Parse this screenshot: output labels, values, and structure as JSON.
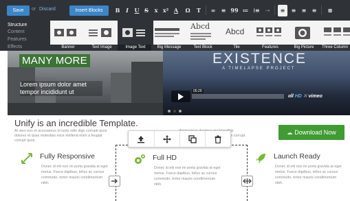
{
  "toolbar": {
    "save_label": "Save",
    "or_label": "or",
    "discard_label": "Discard",
    "insert_label": "Insert Blocks",
    "format": [
      "B",
      "I",
      "U",
      "S",
      "x",
      "x²",
      "A",
      "Ω",
      "T",
      "∞",
      "≡",
      "99",
      "≔",
      "⁝≡",
      "⇥",
      "≡",
      "≡",
      "≡",
      "≡",
      "⊞"
    ]
  },
  "categories": [
    "Structure",
    "Content",
    "Features",
    "Effects"
  ],
  "blocks": [
    "Banner",
    "Text Image",
    "Image Text",
    "Big Message",
    "Text Block",
    "Tile",
    "Features",
    "Big Picture",
    "Three Column"
  ],
  "block_text": {
    "abcd": "Abcd"
  },
  "hero": {
    "heading": "MANY MORE",
    "text": "Lorem ipsum dolor amet tempor incididunt ut",
    "video_title": "EXISTENCE",
    "video_subtitle": "A TIMELAPSE PROJECT",
    "video_time": "05:29",
    "hd_label": "HD",
    "vimeo_label": "vimeo"
  },
  "content": {
    "heading": "Unify is an incredible Template.",
    "intro": "At vero eos et accusamus et iusto odio dign corrupti quos dolores et quas molestias exce eleifend enim a feugiat corrupt quos.",
    "intro_mid": "dignissimos ducimus qui blanditiis molestias excepturi eleifend enim corrupt.",
    "download_label": "Download Now"
  },
  "features": [
    {
      "title": "Fully Responsive",
      "body": "Donec id elit non mi porta gravida at eget metus. Fusce dapibus, tellus ac cursus commodo, tortor mauris condimentum nibh."
    },
    {
      "title": "Full HD",
      "body": "Donec id elit non mi porta gravida at eget metus. Fusce dapibus, tellus ac cursus commodo, tortor mauris condimentum nibh."
    },
    {
      "title": "Launch Ready",
      "body": "Donec id elit non mi porta gravida at eget metus. Fusce dapibus, tellus ac cursus commodo, tortor mauris condimentum nibh."
    }
  ],
  "icons": {
    "float_toolbar": [
      "upload-icon",
      "move-icon",
      "duplicate-icon",
      "delete-icon"
    ],
    "features": [
      "resize-icon",
      "gears-icon",
      "rocket-icon"
    ]
  },
  "colors": {
    "toolbar_bg": "#2f3338",
    "primary_button": "#3b86c9",
    "accent_green": "#3f9b32",
    "link": "#7fb2e5"
  }
}
